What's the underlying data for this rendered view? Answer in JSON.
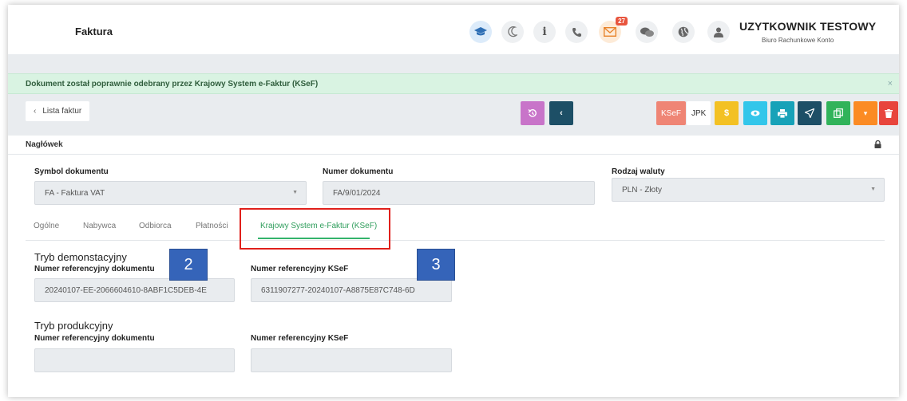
{
  "header": {
    "title": "Faktura",
    "icons": [
      "graduation-cap-icon",
      "moon-icon",
      "info-icon",
      "phone-icon",
      "mail-icon",
      "chat-icon",
      "globe-icon",
      "user-icon"
    ],
    "mail_badge": "27",
    "user_name": "UZYTKOWNIK TESTOWY",
    "user_sub": "Biuro Rachunkowe Konto"
  },
  "alert": {
    "message": "Dokument został poprawnie odebrany przez Krajowy System e-Faktur (KSeF)",
    "close": "×"
  },
  "toolbar": {
    "back_label": "Lista faktur",
    "back_chevron": "‹",
    "ksef_label": "KSeF",
    "jpk_label": "JPK",
    "colors": {
      "history": "#c874c9",
      "prev": "#1d4f66",
      "ksef": "#ef8575",
      "yellow": "#f3c124",
      "cyan": "#33c6ea",
      "print": "#17a2b8",
      "send": "#1d4f66",
      "copy": "#31b35a",
      "orange": "#fb8b24",
      "delete": "#e8453c"
    }
  },
  "section": {
    "title": "Nagłówek"
  },
  "form": {
    "symbol_label": "Symbol dokumentu",
    "symbol_value": "FA - Faktura VAT",
    "number_label": "Numer dokumentu",
    "number_value": "FA/9/01/2024",
    "currency_label": "Rodzaj waluty",
    "currency_value": "PLN - Złoty"
  },
  "tabs": [
    "Ogólne",
    "Nabywca",
    "Odbiorca",
    "Płatności",
    "Krajowy System e-Faktur (KSeF)"
  ],
  "ksef": {
    "demo_title": "Tryb demonstacyjny",
    "prod_title": "Tryb produkcyjny",
    "doc_ref_label": "Numer referencyjny dokumentu",
    "ksef_ref_label": "Numer referencyjny KSeF",
    "demo_doc_ref": "20240107-EE-2066604610-8ABF1C5DEB-4E",
    "demo_ksef_ref": "6311907277-20240107-A8875E87C748-6D",
    "prod_doc_ref": "",
    "prod_ksef_ref": ""
  },
  "annotations": {
    "badge_2": "2",
    "badge_3": "3"
  }
}
